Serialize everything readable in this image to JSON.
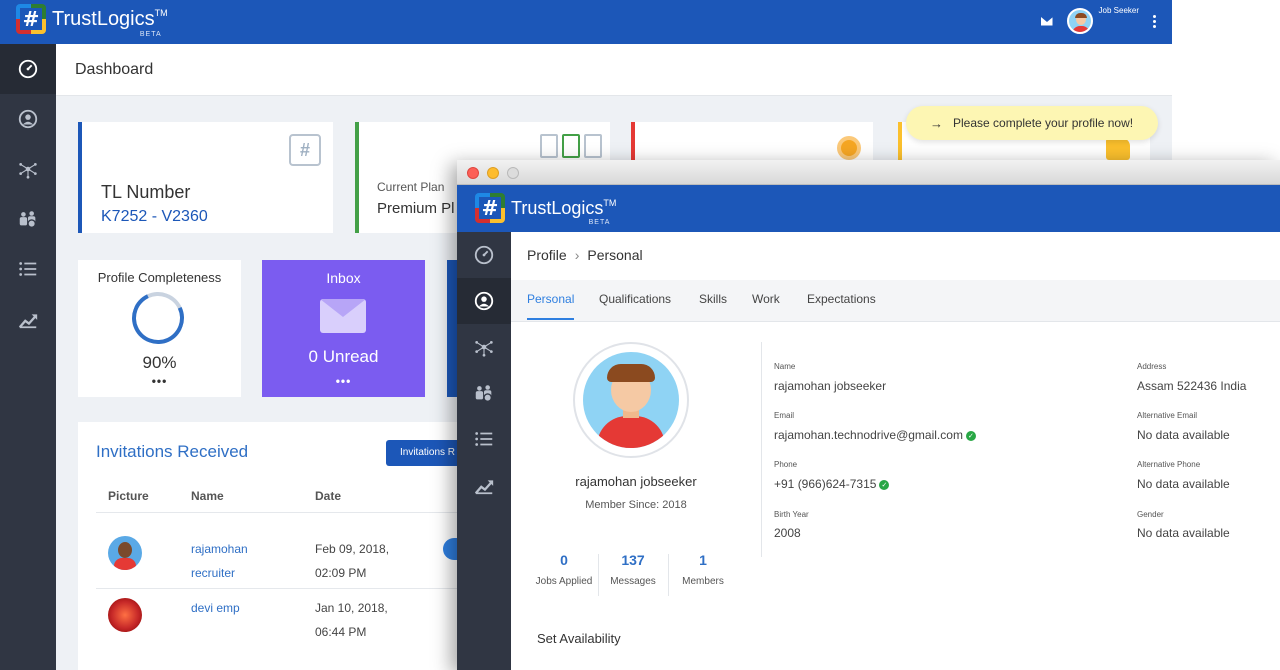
{
  "brand": {
    "name": "TrustLogics",
    "tm": "TM",
    "beta": "BETA",
    "mark": "#"
  },
  "back_window": {
    "user_role": "Job Seeker",
    "header_title": "Dashboard",
    "tl_card": {
      "title": "TL Number",
      "value": "K7252 - V2360"
    },
    "plan_card": {
      "label": "Current Plan",
      "value": "Premium Pl"
    },
    "banner": {
      "arrow": "→",
      "text": "Please complete your profile now!"
    },
    "profile_completeness": {
      "label": "Profile Completeness",
      "value": "90%",
      "more": "•••",
      "fraction": 0.9
    },
    "inbox": {
      "label": "Inbox",
      "value": "0 Unread",
      "more": "•••"
    },
    "invitations": {
      "title": "Invitations Received",
      "button": "Invitations R",
      "columns": [
        "Picture",
        "Name",
        "Date"
      ],
      "rows": [
        {
          "name": [
            "rajamohan",
            "recruiter"
          ],
          "date": [
            "Feb 09, 2018,",
            "02:09 PM"
          ]
        },
        {
          "name": [
            "devi emp"
          ],
          "date": [
            "Jan 10, 2018,",
            "06:44 PM"
          ]
        }
      ]
    }
  },
  "front_window": {
    "breadcrumb": {
      "parent": "Profile",
      "sep": "›",
      "current": "Personal"
    },
    "tabs": [
      "Personal",
      "Qualifications",
      "Skills",
      "Work",
      "Expectations"
    ],
    "profile": {
      "name": "rajamohan jobseeker",
      "member_since": "Member Since: 2018",
      "stats": [
        {
          "value": "0",
          "label": "Jobs Applied"
        },
        {
          "value": "137",
          "label": "Messages"
        },
        {
          "value": "1",
          "label": "Members"
        }
      ],
      "set_availability": "Set Availability"
    },
    "fields_left": [
      {
        "label": "Name",
        "value": "rajamohan jobseeker",
        "verified": false
      },
      {
        "label": "Email",
        "value": "rajamohan.technodrive@gmail.com",
        "verified": true
      },
      {
        "label": "Phone",
        "value": "+91 (966)624-7315",
        "verified": true
      },
      {
        "label": "Birth Year",
        "value": "2008",
        "verified": false
      }
    ],
    "fields_right": [
      {
        "label": "Address",
        "value": "Assam 522436 India"
      },
      {
        "label": "Alternative Email",
        "value": "No data available"
      },
      {
        "label": "Alternative Phone",
        "value": "No data available"
      },
      {
        "label": "Gender",
        "value": "No data available"
      }
    ]
  },
  "colors": {
    "primary": "#1c57b8",
    "sidebar": "#303643",
    "accent": "#2f7fe0",
    "inbox": "#7b5cf0",
    "verified": "#28a745"
  },
  "icons": [
    "dashboard-gauge-icon",
    "user-circle-icon",
    "network-icon",
    "group-icon",
    "list-icon",
    "trend-chart-icon",
    "mail-icon",
    "kebab-menu-icon"
  ]
}
